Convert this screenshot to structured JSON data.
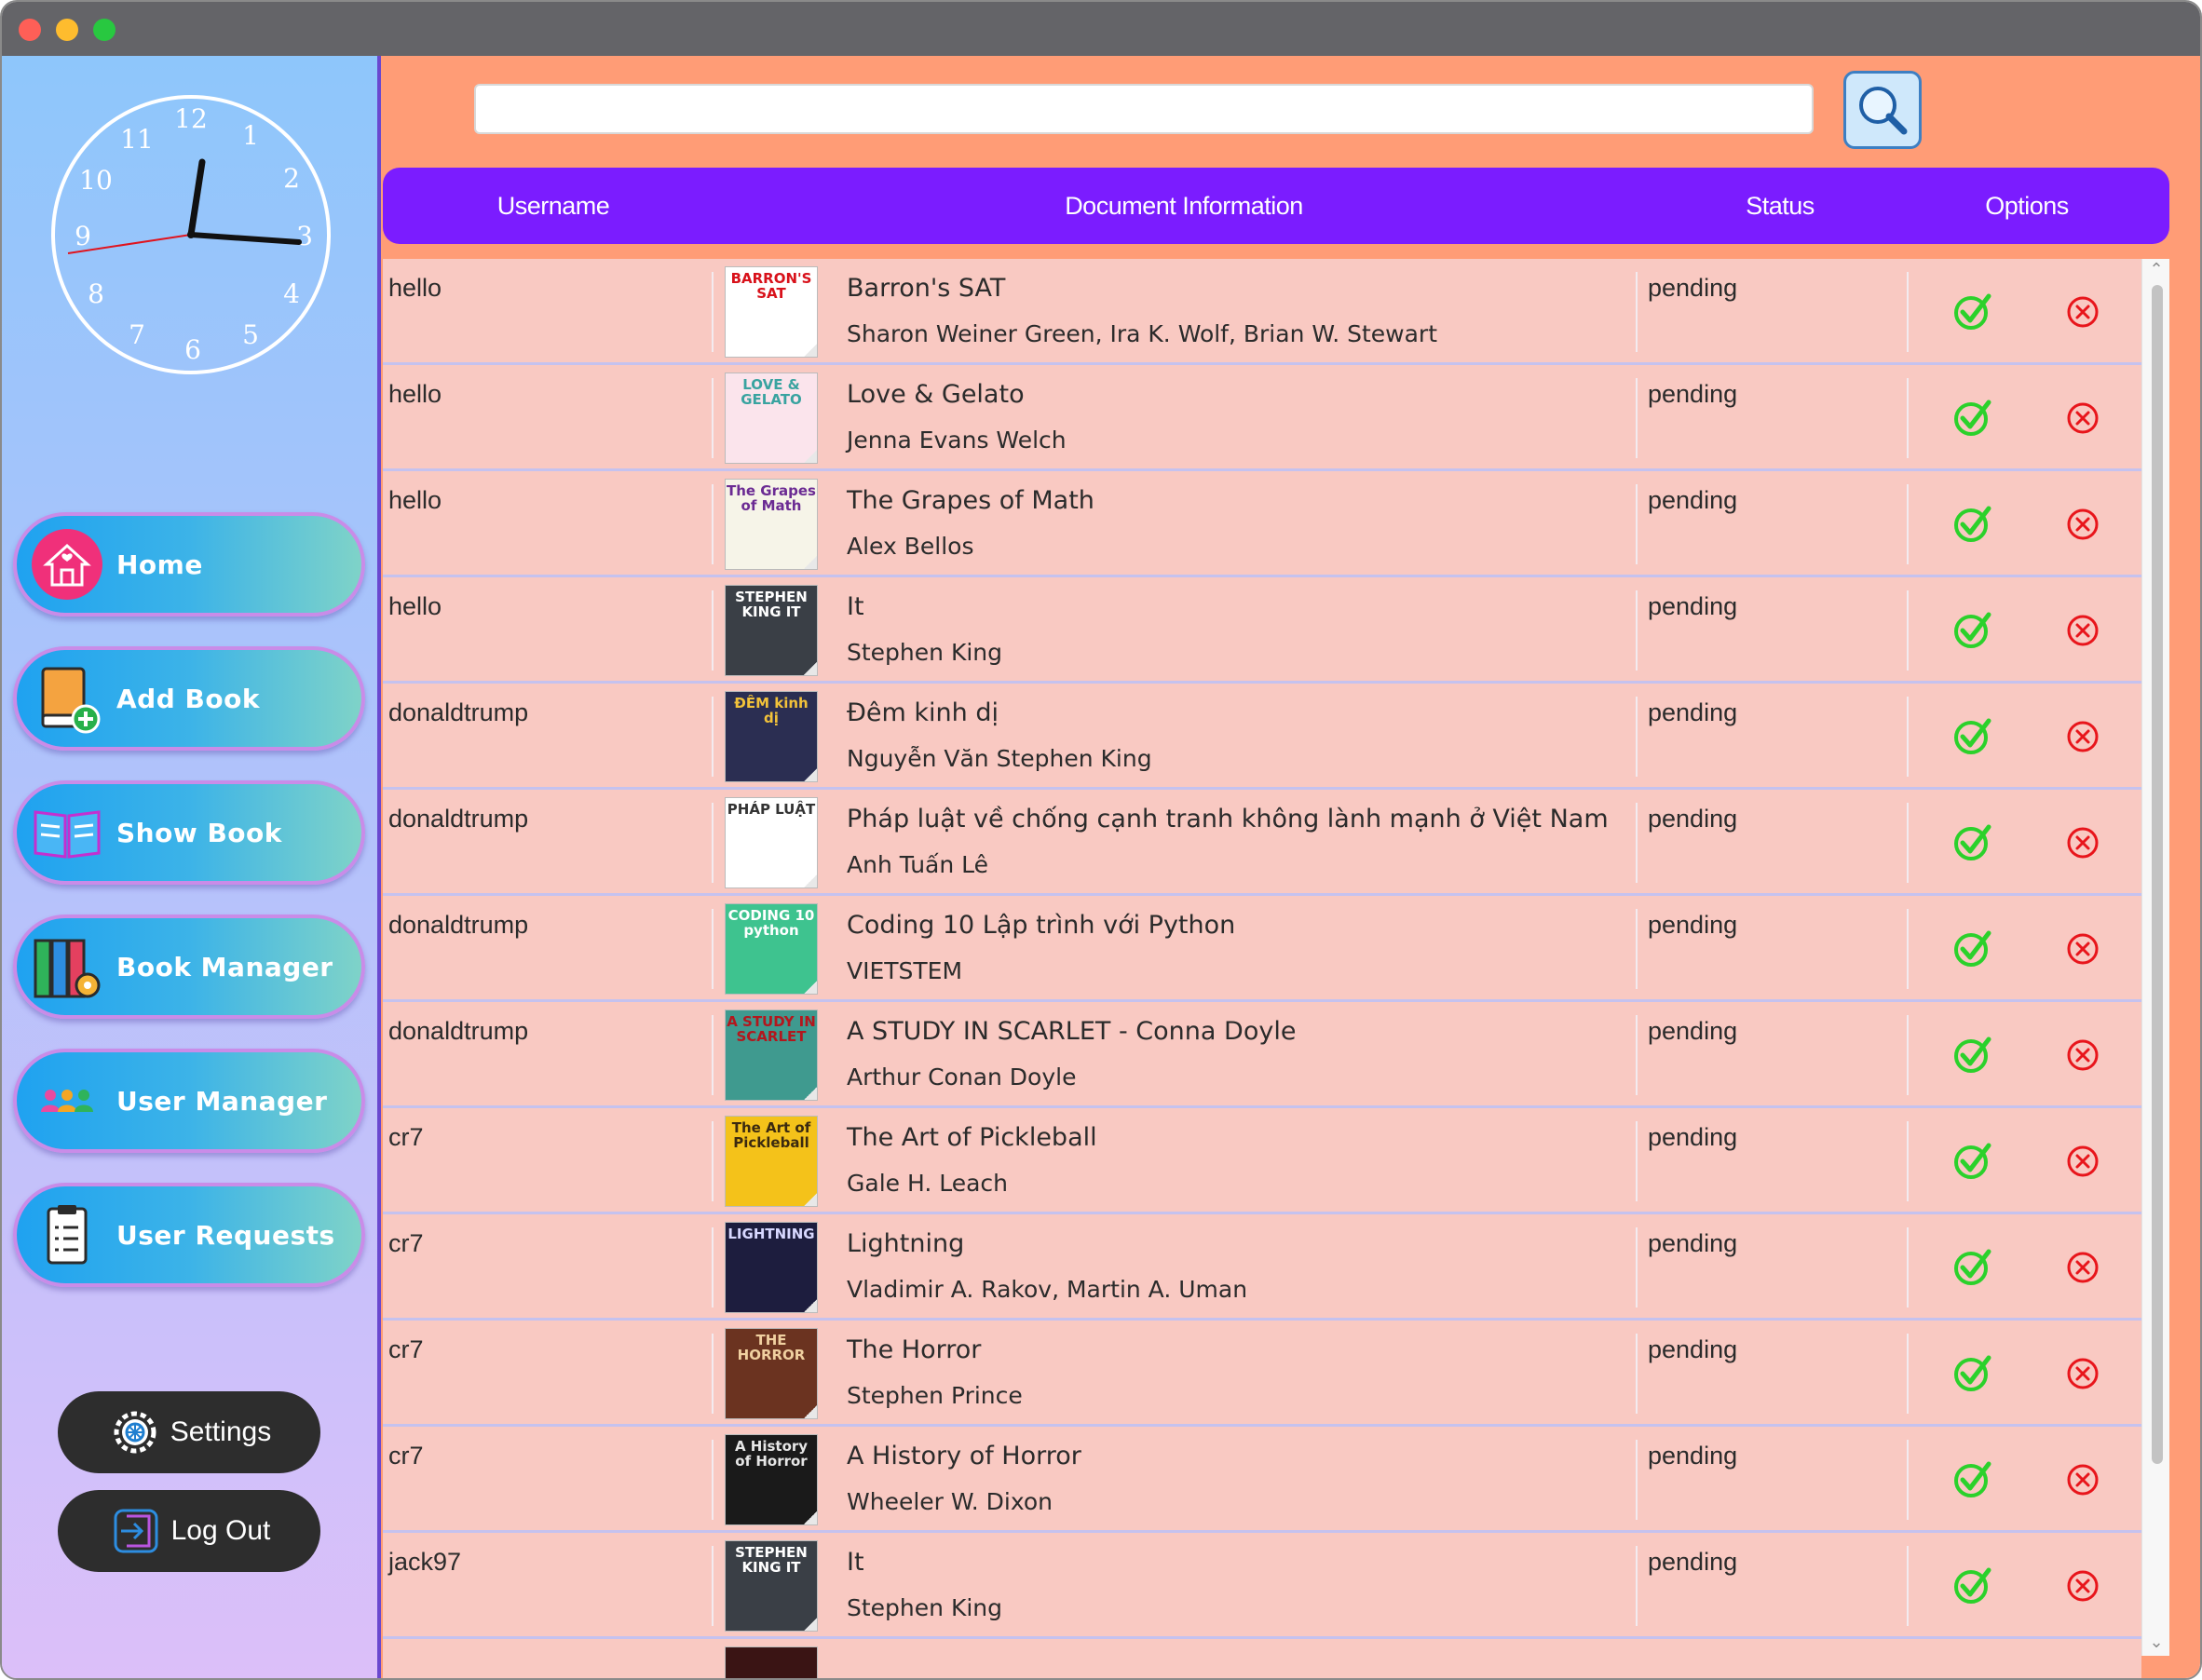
{
  "window": {
    "buttons": [
      "close",
      "minimize",
      "zoom"
    ]
  },
  "sidebar": {
    "clock": {
      "numerals": [
        "12",
        "1",
        "2",
        "3",
        "4",
        "5",
        "6",
        "7",
        "8",
        "9",
        "10",
        "11"
      ],
      "face_color": "#ffffff",
      "second_hand_color": "#e0141e"
    },
    "nav": [
      {
        "label": "Home",
        "icon": "home-icon"
      },
      {
        "label": "Add Book",
        "icon": "add-book-icon"
      },
      {
        "label": "Show Book",
        "icon": "open-book-icon"
      },
      {
        "label": "Book Manager",
        "icon": "book-manager-icon"
      },
      {
        "label": "User Manager",
        "icon": "users-icon"
      },
      {
        "label": "User Requests",
        "icon": "clipboard-icon"
      }
    ],
    "settings_label": "Settings",
    "settings_icon": "gear-icon",
    "logout_label": "Log Out",
    "logout_icon": "logout-icon"
  },
  "search": {
    "value": "",
    "placeholder": "",
    "icon": "search-icon"
  },
  "table": {
    "headers": {
      "username": "Username",
      "document": "Document Information",
      "status": "Status",
      "options": "Options"
    },
    "header_color": "#7b1cff",
    "row_color": "#f9c9c2",
    "approve_icon": "check-circle-icon",
    "approve_color": "#2bd12b",
    "reject_icon": "x-circle-icon",
    "reject_color": "#e8151b",
    "rows": [
      {
        "username": "hello",
        "title": "Barron's SAT",
        "author": "Sharon Weiner Green, Ira K. Wolf, Brian W. Stewart",
        "status": "pending",
        "cover_text": "BARRON'S SAT",
        "cover_bg": "#ffffff",
        "cover_fg": "#d8111a"
      },
      {
        "username": "hello",
        "title": "Love & Gelato",
        "author": "Jenna Evans Welch",
        "status": "pending",
        "cover_text": "LOVE & GELATO",
        "cover_bg": "#fbe4ec",
        "cover_fg": "#39a3a0"
      },
      {
        "username": "hello",
        "title": "The Grapes of Math",
        "author": "Alex Bellos",
        "status": "pending",
        "cover_text": "The Grapes of Math",
        "cover_bg": "#f6f4e8",
        "cover_fg": "#6b2b93"
      },
      {
        "username": "hello",
        "title": "It",
        "author": "Stephen King",
        "status": "pending",
        "cover_text": "STEPHEN KING IT",
        "cover_bg": "#3a3f46",
        "cover_fg": "#ffffff"
      },
      {
        "username": "donaldtrump",
        "title": "Đêm kinh dị",
        "author": "Nguyễn Văn Stephen King",
        "status": "pending",
        "cover_text": "ĐÊM kinh dị",
        "cover_bg": "#2b2e52",
        "cover_fg": "#f2c23a"
      },
      {
        "username": "donaldtrump",
        "title": "Pháp luật về chống cạnh tranh không lành mạnh ở Việt Nam",
        "author": "Anh Tuấn Lê",
        "status": "pending",
        "cover_text": "PHÁP LUẬT",
        "cover_bg": "#ffffff",
        "cover_fg": "#333333"
      },
      {
        "username": "donaldtrump",
        "title": "Coding 10 Lập trình với Python",
        "author": "VIETSTEM",
        "status": "pending",
        "cover_text": "CODING 10 python",
        "cover_bg": "#3ec38f",
        "cover_fg": "#ffffff"
      },
      {
        "username": "donaldtrump",
        "title": "A STUDY IN SCARLET - Conna Doyle",
        "author": "Arthur Conan Doyle",
        "status": "pending",
        "cover_text": "A STUDY IN SCARLET",
        "cover_bg": "#3f9a8f",
        "cover_fg": "#b3171d"
      },
      {
        "username": "cr7",
        "title": "The Art of Pickleball",
        "author": "Gale H. Leach",
        "status": "pending",
        "cover_text": "The Art of Pickleball",
        "cover_bg": "#f4c21a",
        "cover_fg": "#3b2a10"
      },
      {
        "username": "cr7",
        "title": "Lightning",
        "author": "Vladimir A. Rakov, Martin A. Uman",
        "status": "pending",
        "cover_text": "LIGHTNING",
        "cover_bg": "#1d1d3e",
        "cover_fg": "#d8d8ff"
      },
      {
        "username": "cr7",
        "title": "The Horror",
        "author": "Stephen Prince",
        "status": "pending",
        "cover_text": "THE HORROR",
        "cover_bg": "#6b3320",
        "cover_fg": "#f0d0a0"
      },
      {
        "username": "cr7",
        "title": "A History of Horror",
        "author": "Wheeler W. Dixon",
        "status": "pending",
        "cover_text": "A History of Horror",
        "cover_bg": "#1a1a1a",
        "cover_fg": "#e6e6e6"
      },
      {
        "username": "jack97",
        "title": "It",
        "author": "Stephen King",
        "status": "pending",
        "cover_text": "STEPHEN KING IT",
        "cover_bg": "#3a3f46",
        "cover_fg": "#ffffff"
      }
    ]
  }
}
